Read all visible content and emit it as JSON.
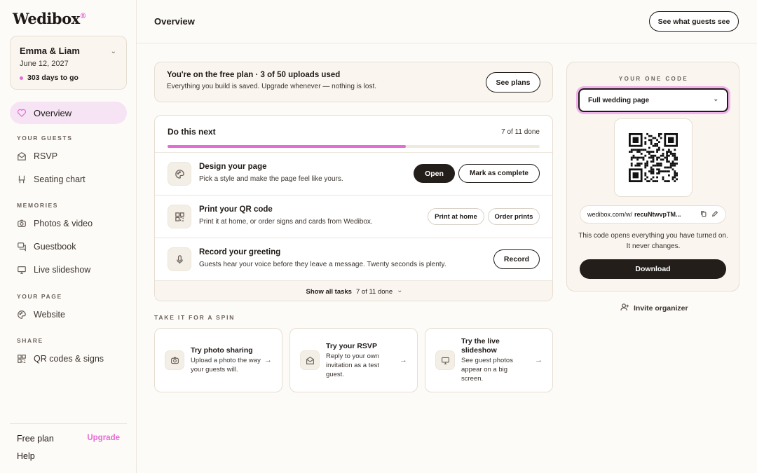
{
  "app": {
    "logo": "Wedibox"
  },
  "couple": {
    "name": "Emma & Liam",
    "date": "June 12, 2027",
    "countdown": "303 days to go"
  },
  "sidebar": {
    "overview": "Overview",
    "sections": {
      "guests": "YOUR GUESTS",
      "memories": "MEMORIES",
      "page": "YOUR PAGE",
      "share": "SHARE"
    },
    "items": {
      "rsvp": "RSVP",
      "seating": "Seating chart",
      "photos": "Photos & video",
      "guestbook": "Guestbook",
      "slideshow": "Live slideshow",
      "website": "Website",
      "qr": "QR codes & signs"
    },
    "plan": "Free plan",
    "upgrade": "Upgrade",
    "help": "Help"
  },
  "header": {
    "title": "Overview",
    "guests_button": "See what guests see"
  },
  "plan_banner": {
    "title": "You're on the free plan · 3 of 50 uploads used",
    "subtitle": "Everything you build is saved. Upgrade whenever — nothing is lost.",
    "button": "See plans"
  },
  "tasks": {
    "title": "Do this next",
    "count": "7 of 11 done",
    "progress_fraction": 0.64,
    "items": [
      {
        "title": "Design your page",
        "desc": "Pick a style and make the page feel like yours.",
        "primary": "Open",
        "secondary": "Mark as complete"
      },
      {
        "title": "Print your QR code",
        "desc": "Print it at home, or order signs and cards from Wedibox.",
        "primary": "Print at home",
        "secondary": "Order prints"
      },
      {
        "title": "Record your greeting",
        "desc": "Guests hear your voice before they leave a message. Twenty seconds is plenty.",
        "primary": "Record"
      }
    ],
    "show_all": "Show all tasks",
    "show_all_count": "7 of 11 done"
  },
  "spin": {
    "label": "TAKE IT FOR A SPIN",
    "cards": [
      {
        "title": "Try photo sharing",
        "desc": "Upload a photo the way your guests will."
      },
      {
        "title": "Try your RSVP",
        "desc": "Reply to your own invitation as a test guest."
      },
      {
        "title": "Try the live slideshow",
        "desc": "See guest photos appear on a big screen."
      }
    ]
  },
  "code_panel": {
    "label": "YOUR ONE CODE",
    "select_value": "Full wedding page",
    "url_prefix": "wedibox.com/w/",
    "url_slug": "recuNtwvpTM...",
    "note": "This code opens everything you have turned on. It never changes.",
    "download": "Download"
  },
  "invite": "Invite organizer"
}
